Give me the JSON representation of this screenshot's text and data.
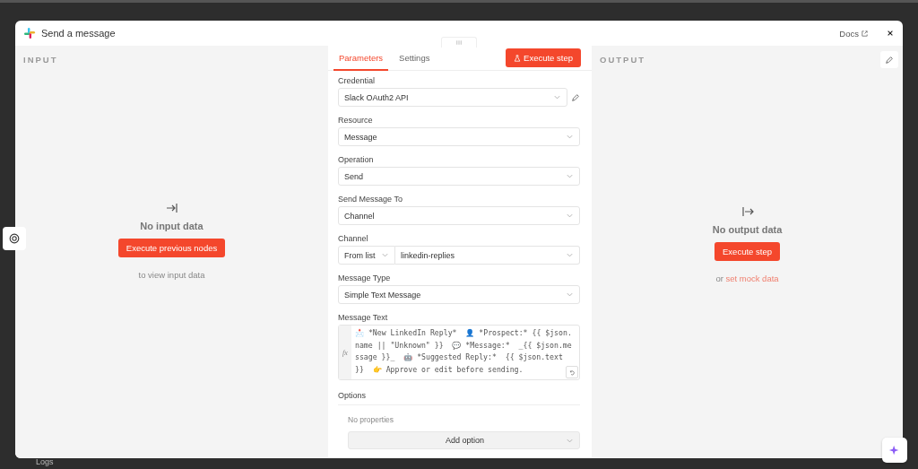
{
  "app": {
    "logs_label": "Logs"
  },
  "modal": {
    "title": "Send a message",
    "docs_link": "Docs",
    "input_panel": {
      "heading": "INPUT",
      "empty_title": "No input data",
      "button": "Execute previous nodes",
      "hint": "to view input data"
    },
    "tabs": [
      {
        "label": "Parameters",
        "selected": true
      },
      {
        "label": "Settings",
        "selected": false
      }
    ],
    "execute_button": "Execute step",
    "fields": [
      {
        "kind": "credential",
        "label": "Credential",
        "value": "Slack OAuth2 API"
      },
      {
        "kind": "select",
        "label": "Resource",
        "value": "Message"
      },
      {
        "kind": "select",
        "label": "Operation",
        "value": "Send"
      },
      {
        "kind": "select",
        "label": "Send Message To",
        "value": "Channel"
      },
      {
        "kind": "channel",
        "label": "Channel",
        "mode": "From list",
        "value": "linkedin-replies"
      },
      {
        "kind": "select",
        "label": "Message Type",
        "value": "Simple Text Message"
      },
      {
        "kind": "code",
        "label": "Message Text",
        "prefix": "fx",
        "value": "📩 *New LinkedIn Reply*  👤 *Prospect:* {{ $json.name || \"Unknown\" }}  💬 *Message:*  _{{ $json.message }}_  🤖 *Suggested Reply:*  {{ $json.text }}  👉 Approve or edit before sending."
      }
    ],
    "options": {
      "label": "Options",
      "empty": "No properties",
      "add_button": "Add option"
    },
    "output_panel": {
      "heading": "OUTPUT",
      "empty_title": "No output data",
      "button": "Execute step",
      "hint_prefix": "or",
      "hint_link": "set mock data"
    }
  }
}
